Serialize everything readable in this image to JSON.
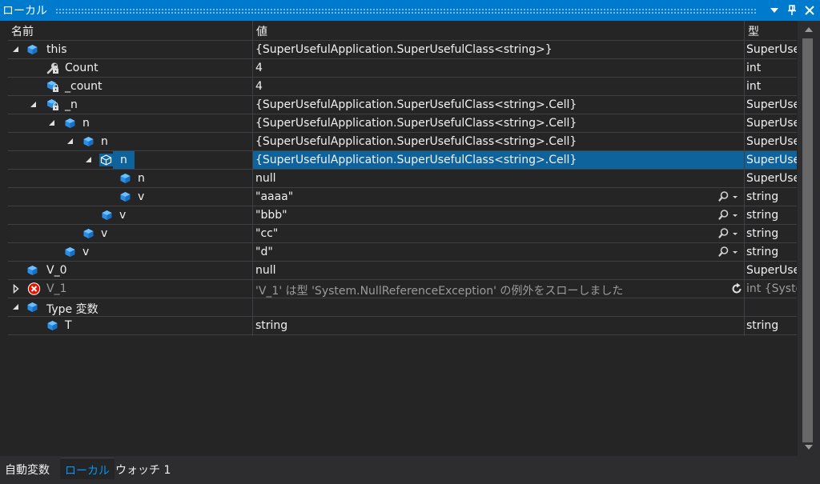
{
  "window": {
    "title": "ローカル"
  },
  "columns": {
    "name": "名前",
    "value": "値",
    "type": "型"
  },
  "rows": [
    {
      "name": "this",
      "value": "{SuperUsefulApplication.SuperUsefulClass<string>}",
      "type": "SuperUse"
    },
    {
      "name": "Count",
      "value": "4",
      "type": "int"
    },
    {
      "name": "_count",
      "value": "4",
      "type": "int"
    },
    {
      "name": "_n",
      "value": "{SuperUsefulApplication.SuperUsefulClass<string>.Cell}",
      "type": "SuperUse"
    },
    {
      "name": "n",
      "value": "{SuperUsefulApplication.SuperUsefulClass<string>.Cell}",
      "type": "SuperUse"
    },
    {
      "name": "n",
      "value": "{SuperUsefulApplication.SuperUsefulClass<string>.Cell}",
      "type": "SuperUse"
    },
    {
      "name": "n",
      "value": "{SuperUsefulApplication.SuperUsefulClass<string>.Cell}",
      "type": "SuperUse"
    },
    {
      "name": "n",
      "value": "null",
      "type": "SuperUse"
    },
    {
      "name": "v",
      "value": "\"aaaa\"",
      "type": "string"
    },
    {
      "name": "v",
      "value": "\"bbb\"",
      "type": "string"
    },
    {
      "name": "v",
      "value": "\"cc\"",
      "type": "string"
    },
    {
      "name": "v",
      "value": "\"d\"",
      "type": "string"
    },
    {
      "name": "V_0",
      "value": "null",
      "type": "SuperUse"
    },
    {
      "name": "V_1",
      "value": "'V_1' は型 'System.NullReferenceException' の例外をスローしました",
      "type": "int {Syste"
    },
    {
      "name": "Type 変数",
      "value": "",
      "type": ""
    },
    {
      "name": "T",
      "value": "string",
      "type": "string"
    }
  ],
  "tabs": [
    {
      "label": "自動変数"
    },
    {
      "label": "ローカル"
    },
    {
      "label": "ウォッチ 1"
    }
  ],
  "colors": {
    "accent": "#007acc",
    "selection": "#0e639c",
    "background": "#252526",
    "active_tab": "#0097fb",
    "error": "#e51400"
  }
}
